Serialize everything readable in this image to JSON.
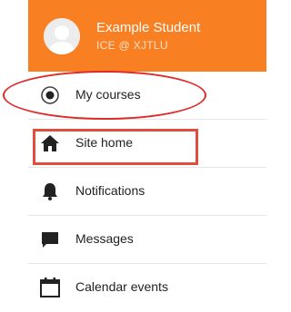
{
  "profile": {
    "name": "Example Student",
    "subtitle": "ICE @ XJTLU",
    "avatar_icon": "user-avatar-placeholder",
    "background_color": "#f97f23"
  },
  "nav": {
    "items": [
      {
        "label": "My courses",
        "icon": "radio-target-icon"
      },
      {
        "label": "Site home",
        "icon": "home-icon"
      },
      {
        "label": "Notifications",
        "icon": "bell-icon"
      },
      {
        "label": "Messages",
        "icon": "speech-bubble-icon"
      },
      {
        "label": "Calendar events",
        "icon": "calendar-icon"
      }
    ]
  },
  "annotations": {
    "highlight_color": "#e02b2b"
  }
}
